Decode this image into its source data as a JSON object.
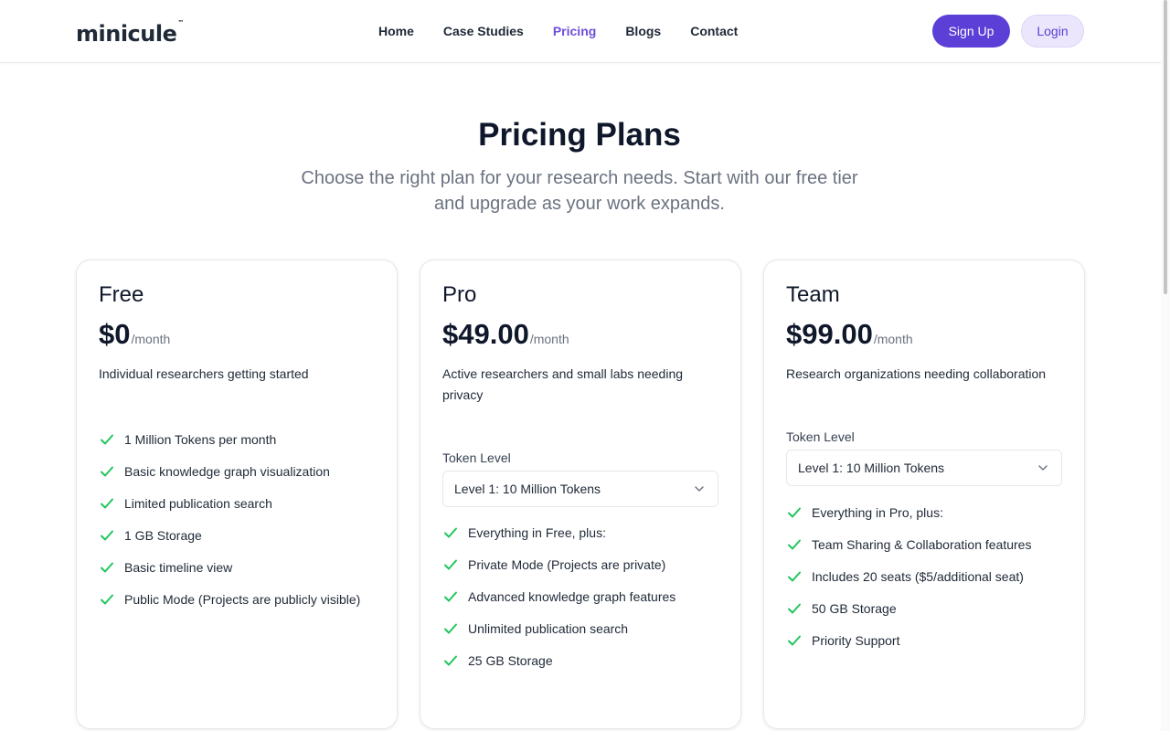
{
  "header": {
    "logo": "minicule",
    "logo_tm": "™",
    "nav": [
      "Home",
      "Case Studies",
      "Pricing",
      "Blogs",
      "Contact"
    ],
    "active_nav": "Pricing",
    "signup_label": "Sign Up",
    "login_label": "Login"
  },
  "hero": {
    "title": "Pricing Plans",
    "subtitle": "Choose the right plan for your research needs. Start with our free tier and upgrade as your work expands."
  },
  "colors": {
    "accent": "#5b3fd6",
    "check": "#22c55e"
  },
  "plans": [
    {
      "name": "Free",
      "price": "$0",
      "period": "/month",
      "description": "Individual researchers getting started",
      "features": [
        "1 Million Tokens per month",
        "Basic knowledge graph visualization",
        "Limited publication search",
        "1 GB Storage",
        "Basic timeline view",
        "Public Mode (Projects are publicly visible)"
      ]
    },
    {
      "name": "Pro",
      "price": "$49.00",
      "period": "/month",
      "description": "Active researchers and small labs needing privacy",
      "token_label": "Token Level",
      "token_value": "Level 1: 10 Million Tokens",
      "features": [
        "Everything in Free, plus:",
        "Private Mode (Projects are private)",
        "Advanced knowledge graph features",
        "Unlimited publication search",
        "25 GB Storage"
      ]
    },
    {
      "name": "Team",
      "price": "$99.00",
      "period": "/month",
      "description": "Research organizations needing collaboration",
      "token_label": "Token Level",
      "token_value": "Level 1: 10 Million Tokens",
      "features": [
        "Everything in Pro, plus:",
        "Team Sharing & Collaboration features",
        "Includes 20 seats ($5/additional seat)",
        "50 GB Storage",
        "Priority Support"
      ]
    }
  ]
}
